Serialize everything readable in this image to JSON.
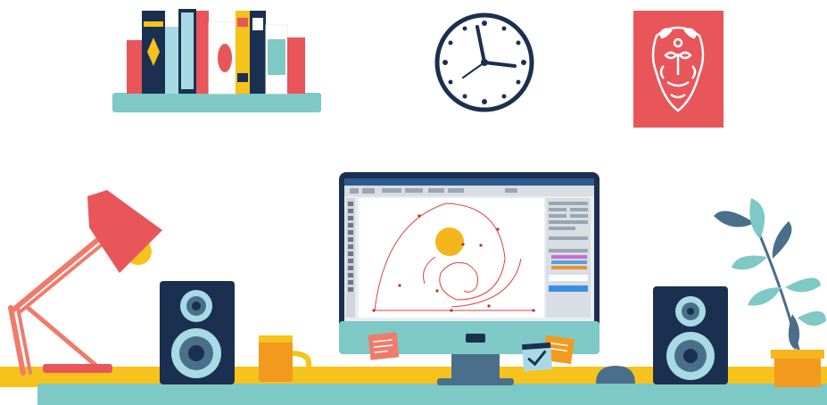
{
  "illustration": {
    "subject": "flat-design-workspace",
    "objects": [
      "bookshelf",
      "wall-clock",
      "tribal-mask-poster",
      "desk-lamp",
      "left-speaker",
      "mug",
      "monitor",
      "photo-editor-screen",
      "sticky-notes",
      "mouse",
      "right-speaker",
      "potted-plant",
      "desk"
    ]
  },
  "clock": {
    "hours": 12,
    "hour_hand_points_to": 2,
    "minute_hand_points_to": 11
  },
  "palette": {
    "navy": "#1b3050",
    "teal": "#7ec9c6",
    "coral": "#e8565a",
    "yellow": "#f5c31c",
    "orange": "#f39a1e",
    "light_blue": "#a8dae6",
    "white": "#ffffff",
    "gray_blue": "#4a6f8a"
  }
}
